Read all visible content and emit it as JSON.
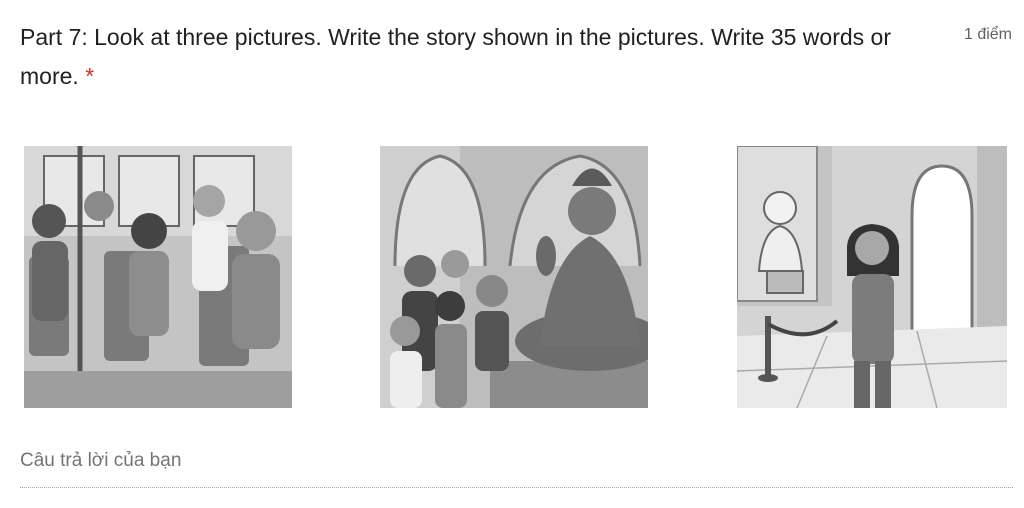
{
  "question": {
    "title": "Part 7: Look at three pictures. Write the story shown in the pictures. Write 35 words or more.",
    "required_mark": "*",
    "points": "1 điểm"
  },
  "pictures": [
    {
      "icon": "bus-passengers-illustration"
    },
    {
      "icon": "buddha-statue-visitors-illustration"
    },
    {
      "icon": "museum-bust-girl-illustration"
    }
  ],
  "answer": {
    "placeholder": "Câu trả lời của bạn"
  },
  "colors": {
    "text": "#202124",
    "required": "#d93025",
    "muted": "#5f6368"
  }
}
